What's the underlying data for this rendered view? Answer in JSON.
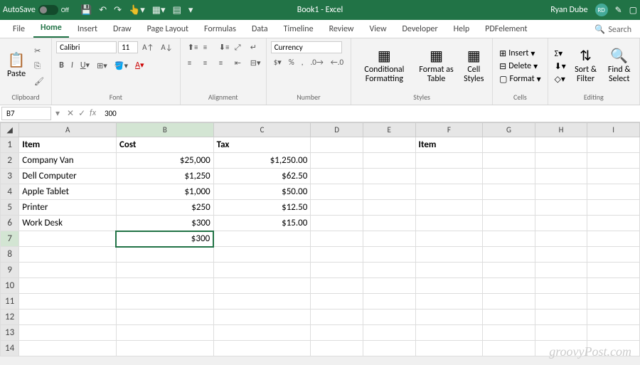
{
  "titlebar": {
    "autosave": "AutoSave",
    "autosave_state": "Off",
    "title": "Book1 - Excel",
    "user": "Ryan Dube",
    "initials": "RD"
  },
  "tabs": [
    "File",
    "Home",
    "Insert",
    "Draw",
    "Page Layout",
    "Formulas",
    "Data",
    "Timeline",
    "Review",
    "View",
    "Developer",
    "Help",
    "PDFelement"
  ],
  "active_tab": "Home",
  "search": "Search",
  "ribbon": {
    "clipboard": {
      "paste": "Paste",
      "label": "Clipboard"
    },
    "font": {
      "name": "Calibri",
      "size": "11",
      "label": "Font"
    },
    "alignment": {
      "label": "Alignment"
    },
    "number": {
      "format": "Currency",
      "label": "Number"
    },
    "styles": {
      "cond": "Conditional Formatting",
      "fmt": "Format as Table",
      "cell": "Cell Styles",
      "label": "Styles"
    },
    "cells": {
      "insert": "Insert",
      "delete": "Delete",
      "format": "Format",
      "label": "Cells"
    },
    "editing": {
      "sort": "Sort & Filter",
      "find": "Find & Select",
      "label": "Editing"
    }
  },
  "formula": {
    "namebox": "B7",
    "value": "300"
  },
  "columns": [
    "A",
    "B",
    "C",
    "D",
    "E",
    "F",
    "G",
    "H",
    "I"
  ],
  "sheet": {
    "headers": {
      "A": "Item",
      "B": "Cost",
      "C": "Tax",
      "F": "Item"
    },
    "rows": [
      {
        "A": "Company Van",
        "B": "$25,000",
        "C": "$1,250.00"
      },
      {
        "A": "Dell Computer",
        "B": "$1,250",
        "C": "$62.50"
      },
      {
        "A": "Apple Tablet",
        "B": "$1,000",
        "C": "$50.00"
      },
      {
        "A": "Printer",
        "B": "$250",
        "C": "$12.50"
      },
      {
        "A": "Work Desk",
        "B": "$300",
        "C": "$15.00"
      },
      {
        "B": "$300"
      }
    ]
  },
  "selected_cell": "B7",
  "watermark": "groovyPost.com"
}
